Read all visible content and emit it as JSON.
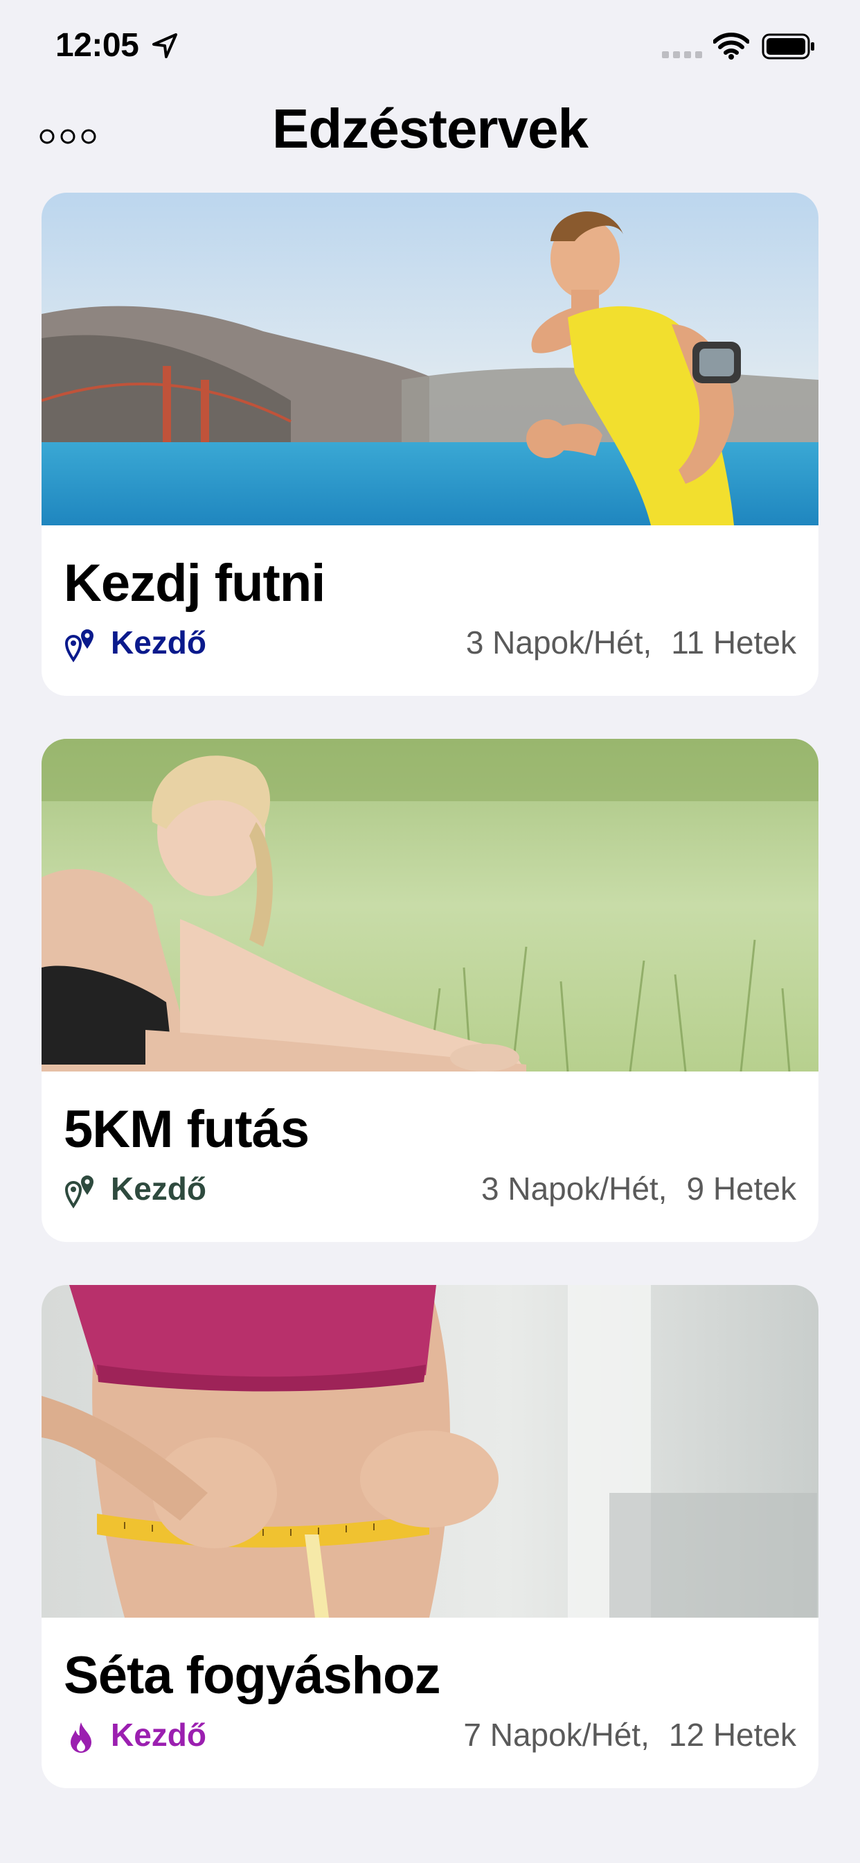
{
  "status_bar": {
    "time": "12:05",
    "icons": [
      "location-arrow-icon",
      "signal-icon",
      "wifi-icon",
      "battery-icon"
    ]
  },
  "nav": {
    "title": "Edzéstervek",
    "more_icon": "more-dots-icon"
  },
  "plans": [
    {
      "title": "Kezdj futni",
      "level": "Kezdő",
      "level_icon": "location-pins-icon",
      "level_color": "#0a1a8c",
      "days": "3 Napok/Hét,",
      "weeks": "11 Hetek"
    },
    {
      "title": "5KM futás",
      "level": "Kezdő",
      "level_icon": "location-pins-icon",
      "level_color": "#2e4a3e",
      "days": "3 Napok/Hét,",
      "weeks": "9 Hetek"
    },
    {
      "title": "Séta fogyáshoz",
      "level": "Kezdő",
      "level_icon": "flame-icon",
      "level_color": "#9b1fb0",
      "days": "7 Napok/Hét,",
      "weeks": "12 Hetek"
    }
  ]
}
